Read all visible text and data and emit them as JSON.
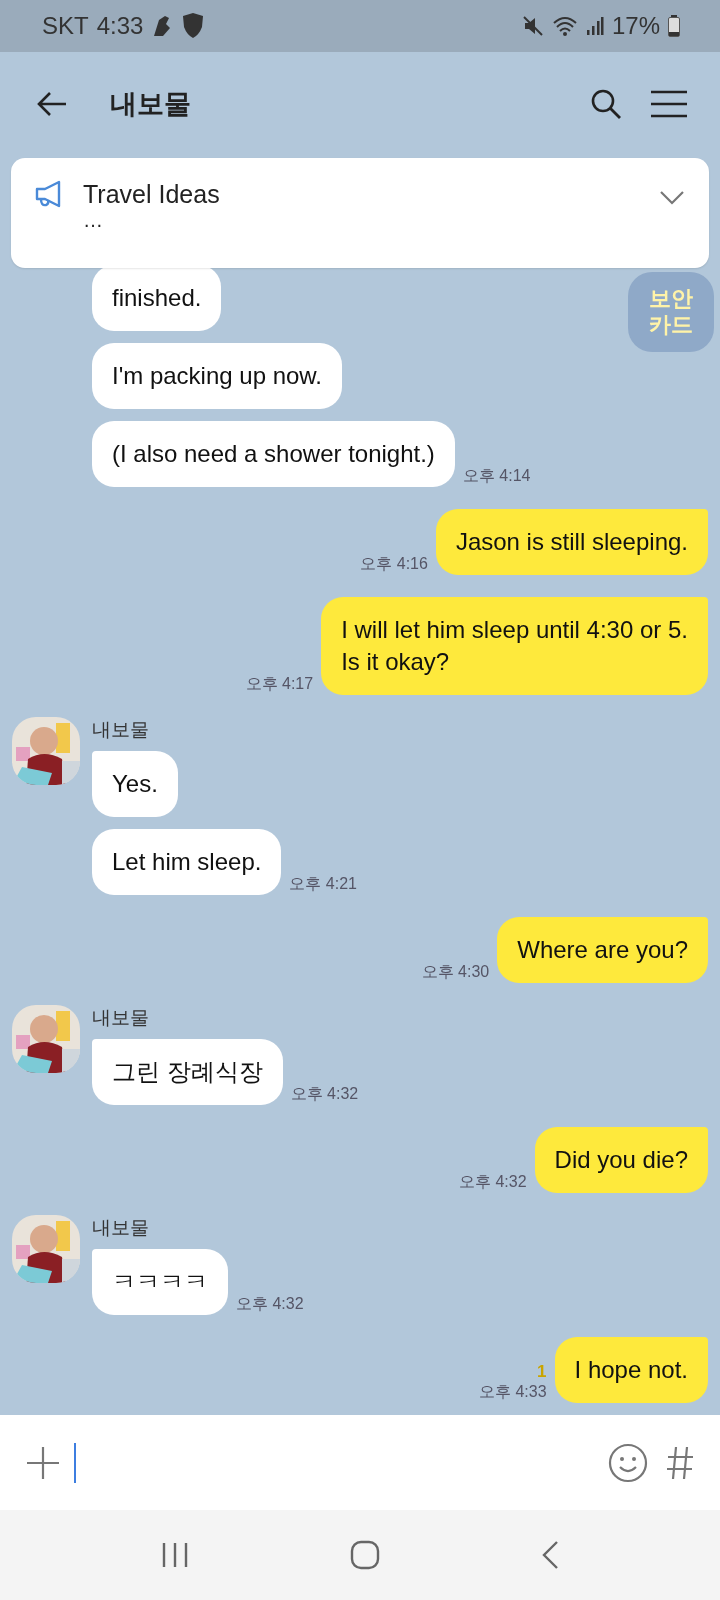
{
  "status_bar": {
    "carrier": "SKT",
    "time": "4:33",
    "battery": "17%"
  },
  "header": {
    "title": "내보물"
  },
  "notice": {
    "title": "Travel Ideas",
    "body": "…",
    "expanded": false
  },
  "floating_button": {
    "label": "보안 카드"
  },
  "messages": [
    {
      "kind": "received",
      "bubbles": [
        {
          "text": "finished."
        },
        {
          "text": "I'm packing up now."
        },
        {
          "text": "(I also need a shower tonight.)",
          "time": "오후 4:14"
        }
      ]
    },
    {
      "kind": "sent",
      "bubbles": [
        {
          "text": "Jason is still sleeping.",
          "time": "오후 4:16"
        }
      ]
    },
    {
      "kind": "sent",
      "bubbles": [
        {
          "text": "I will let him sleep until 4:30 or 5.\nIs it okay?",
          "time": "오후 4:17"
        }
      ]
    },
    {
      "kind": "received",
      "sender": "내보물",
      "bubbles": [
        {
          "text": "Yes."
        },
        {
          "text": "Let him sleep.",
          "time": "오후 4:21"
        }
      ]
    },
    {
      "kind": "sent",
      "bubbles": [
        {
          "text": "Where are you?",
          "time": "오후 4:30"
        }
      ]
    },
    {
      "kind": "received",
      "sender": "내보물",
      "bubbles": [
        {
          "text": "그린 장례식장",
          "time": "오후 4:32"
        }
      ]
    },
    {
      "kind": "sent",
      "bubbles": [
        {
          "text": "Did you die?",
          "time": "오후 4:32"
        }
      ]
    },
    {
      "kind": "received",
      "sender": "내보물",
      "bubbles": [
        {
          "text": "ㅋㅋㅋㅋ",
          "time": "오후 4:32"
        }
      ]
    },
    {
      "kind": "sent",
      "bubbles": [
        {
          "text": "I hope not.",
          "time": "오후 4:33",
          "unread": "1"
        }
      ]
    }
  ]
}
